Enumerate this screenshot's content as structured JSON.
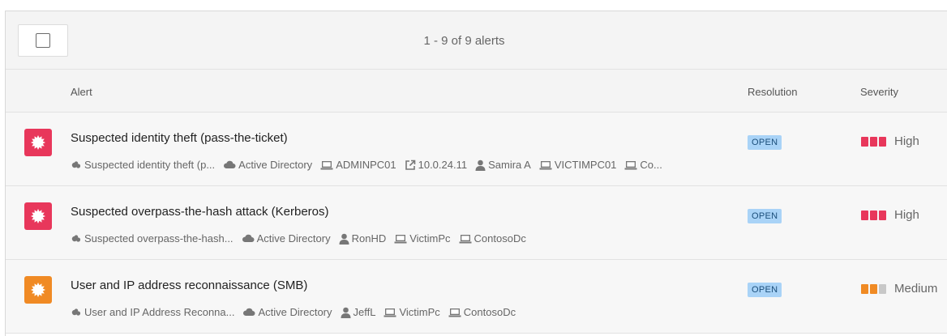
{
  "toolbar": {
    "count_text": "1 - 9 of 9 alerts"
  },
  "columns": {
    "alert": "Alert",
    "resolution": "Resolution",
    "severity": "Severity"
  },
  "colors": {
    "high": "#e8375b",
    "medium": "#f08a24",
    "inactive": "#c8c8c8",
    "badge": "#a9d3f7"
  },
  "alerts": [
    {
      "title": "Suspected identity theft (pass-the-ticket)",
      "icon_color": "#e8375b",
      "entities": [
        {
          "icon": "alert-type-icon",
          "text": "Suspected identity theft (p..."
        },
        {
          "icon": "cloud-icon",
          "text": "Active Directory"
        },
        {
          "icon": "computer-icon",
          "text": "ADMINPC01"
        },
        {
          "icon": "external-ip-icon",
          "text": "10.0.24.11"
        },
        {
          "icon": "user-icon",
          "text": "Samira A"
        },
        {
          "icon": "computer-icon",
          "text": "VICTIMPC01"
        },
        {
          "icon": "computer-icon",
          "text": "Co..."
        }
      ],
      "resolution": "OPEN",
      "severity": "High",
      "severity_level": 3
    },
    {
      "title": "Suspected overpass-the-hash attack (Kerberos)",
      "icon_color": "#e8375b",
      "entities": [
        {
          "icon": "alert-type-icon",
          "text": "Suspected overpass-the-hash..."
        },
        {
          "icon": "cloud-icon",
          "text": "Active Directory"
        },
        {
          "icon": "user-icon",
          "text": "RonHD"
        },
        {
          "icon": "computer-icon",
          "text": "VictimPc"
        },
        {
          "icon": "computer-icon",
          "text": "ContosoDc"
        }
      ],
      "resolution": "OPEN",
      "severity": "High",
      "severity_level": 3
    },
    {
      "title": "User and IP address reconnaissance (SMB)",
      "icon_color": "#f08a24",
      "entities": [
        {
          "icon": "alert-type-icon",
          "text": "User and IP Address Reconna..."
        },
        {
          "icon": "cloud-icon",
          "text": "Active Directory"
        },
        {
          "icon": "user-icon",
          "text": "JeffL"
        },
        {
          "icon": "computer-icon",
          "text": "VictimPc"
        },
        {
          "icon": "computer-icon",
          "text": "ContosoDc"
        }
      ],
      "resolution": "OPEN",
      "severity": "Medium",
      "severity_level": 2
    }
  ]
}
